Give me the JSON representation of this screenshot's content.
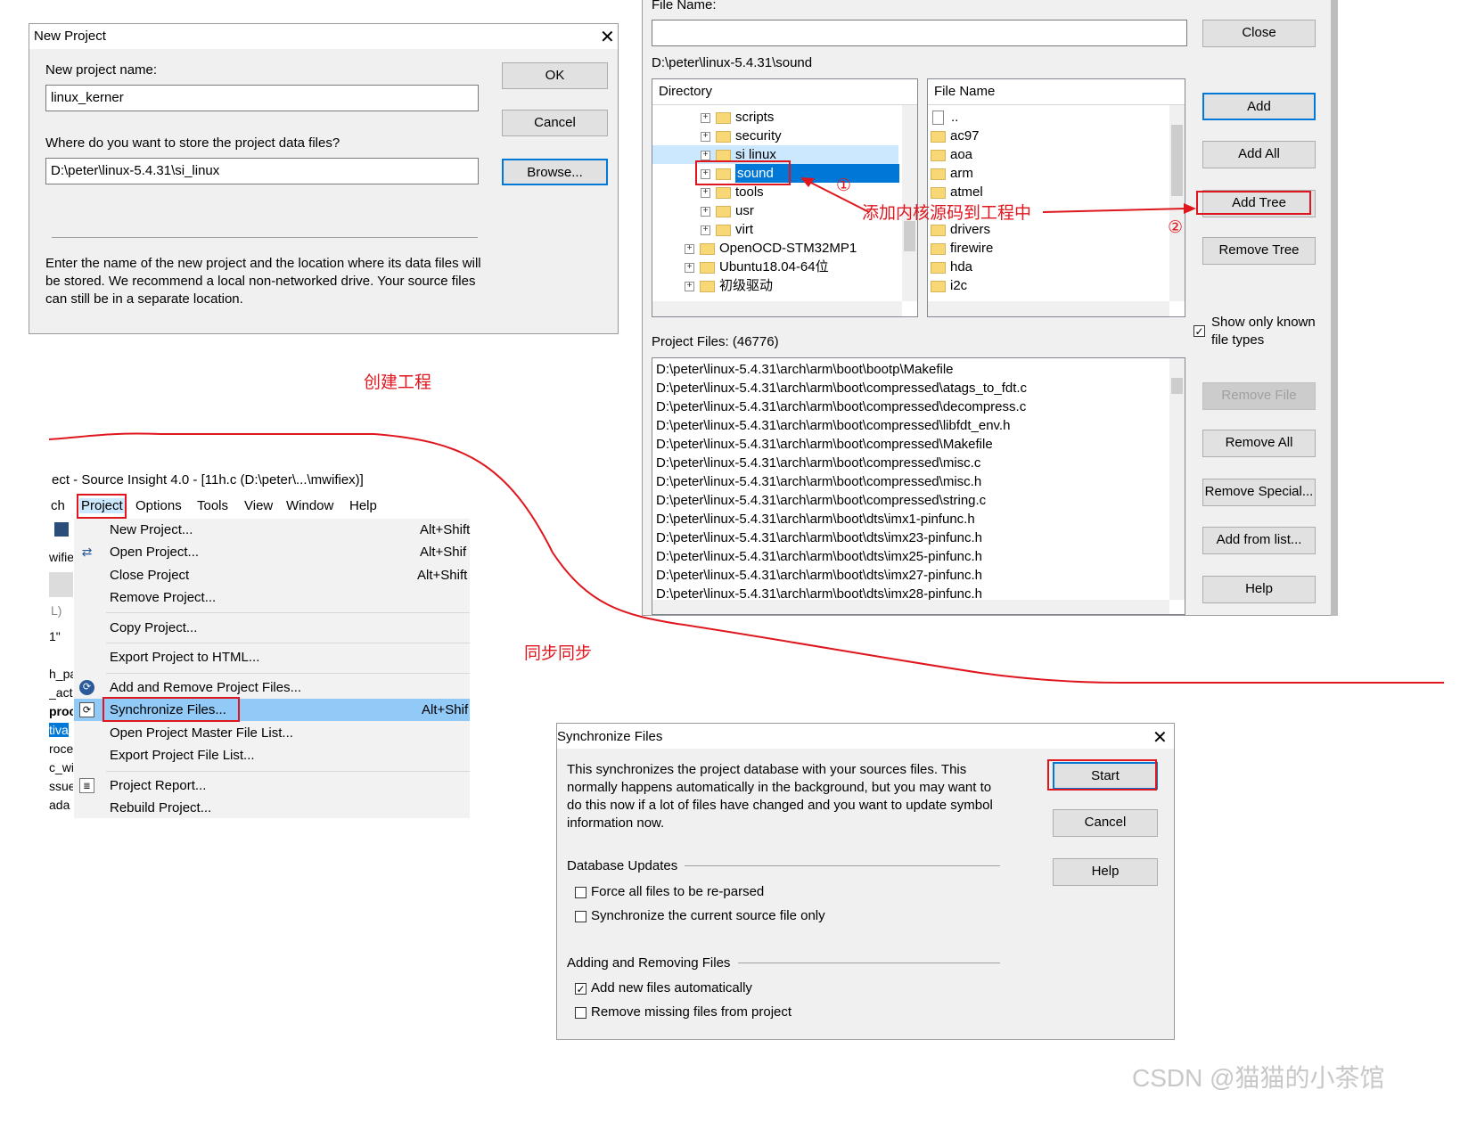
{
  "new_project": {
    "title": "New Project",
    "name_label": "New project name:",
    "name_value": "linux_kerner",
    "store_label": "Where do you want to store the project data files?",
    "store_value": "D:\\peter\\linux-5.4.31\\si_linux",
    "ok": "OK",
    "cancel": "Cancel",
    "browse": "Browse...",
    "description": "Enter the name of the new project and the location where its data files will be stored. We recommend a local non-networked drive. Your source files can still be in a separate location."
  },
  "add_files": {
    "file_name_label": "File Name:",
    "path": "D:\\peter\\linux-5.4.31\\sound",
    "directory_header": "Directory",
    "filename_header": "File Name",
    "directories": [
      {
        "label": "scripts"
      },
      {
        "label": "security"
      },
      {
        "label": "si linux"
      },
      {
        "label": "sound"
      },
      {
        "label": "tools"
      },
      {
        "label": "usr"
      },
      {
        "label": "virt"
      },
      {
        "label": "OpenOCD-STM32MP1"
      },
      {
        "label": "Ubuntu18.04-64位"
      },
      {
        "label": "初级驱动"
      }
    ],
    "files": [
      "..",
      "ac97",
      "aoa",
      "arm",
      "atmel",
      "drivers",
      "firewire",
      "hda",
      "i2c"
    ],
    "project_files_label": "Project Files: (46776)",
    "project_files": [
      "D:\\peter\\linux-5.4.31\\arch\\arm\\boot\\bootp\\Makefile",
      "D:\\peter\\linux-5.4.31\\arch\\arm\\boot\\compressed\\atags_to_fdt.c",
      "D:\\peter\\linux-5.4.31\\arch\\arm\\boot\\compressed\\decompress.c",
      "D:\\peter\\linux-5.4.31\\arch\\arm\\boot\\compressed\\libfdt_env.h",
      "D:\\peter\\linux-5.4.31\\arch\\arm\\boot\\compressed\\Makefile",
      "D:\\peter\\linux-5.4.31\\arch\\arm\\boot\\compressed\\misc.c",
      "D:\\peter\\linux-5.4.31\\arch\\arm\\boot\\compressed\\misc.h",
      "D:\\peter\\linux-5.4.31\\arch\\arm\\boot\\compressed\\string.c",
      "D:\\peter\\linux-5.4.31\\arch\\arm\\boot\\dts\\imx1-pinfunc.h",
      "D:\\peter\\linux-5.4.31\\arch\\arm\\boot\\dts\\imx23-pinfunc.h",
      "D:\\peter\\linux-5.4.31\\arch\\arm\\boot\\dts\\imx25-pinfunc.h",
      "D:\\peter\\linux-5.4.31\\arch\\arm\\boot\\dts\\imx27-pinfunc.h",
      "D:\\peter\\linux-5.4.31\\arch\\arm\\boot\\dts\\imx28-pinfunc.h"
    ],
    "buttons": {
      "close": "Close",
      "add": "Add",
      "add_all": "Add All",
      "add_tree": "Add Tree",
      "remove_tree": "Remove Tree",
      "remove_file": "Remove File",
      "remove_all": "Remove All",
      "remove_special": "Remove Special...",
      "add_from_list": "Add from list...",
      "help": "Help"
    },
    "show_known_label": "Show only known file types",
    "show_known_checked": true
  },
  "menu": {
    "window_title": "ect - Source Insight 4.0 - [11h.c (D:\\peter\\...\\mwifiex)]",
    "menubar": [
      "ch",
      "Project",
      "Options",
      "Tools",
      "View",
      "Window",
      "Help"
    ],
    "items": [
      {
        "label": "New Project...",
        "shortcut": "Alt+Shift"
      },
      {
        "label": "Open Project...",
        "shortcut": "Alt+Shif"
      },
      {
        "label": "Close Project",
        "shortcut": "Alt+Shift"
      },
      {
        "label": "Remove Project...",
        "shortcut": ""
      },
      {
        "label": "Copy Project...",
        "shortcut": ""
      },
      {
        "label": "Export Project to HTML...",
        "shortcut": ""
      },
      {
        "label": "Add and Remove Project Files...",
        "shortcut": ""
      },
      {
        "label": "Synchronize Files...",
        "shortcut": "Alt+Shif"
      },
      {
        "label": "Open Project Master File List...",
        "shortcut": ""
      },
      {
        "label": "Export Project File List...",
        "shortcut": ""
      },
      {
        "label": "Project Report...",
        "shortcut": ""
      },
      {
        "label": "Rebuild Project...",
        "shortcut": ""
      }
    ],
    "left_fragments": [
      "wifie",
      "L)",
      "1\"",
      "h_pa",
      "_acti",
      "proc",
      "tiva",
      "roce",
      "c_wi",
      "ssue",
      "ada"
    ]
  },
  "sync": {
    "title": "Synchronize Files",
    "description": "This synchronizes the project database with your sources files. This normally happens automatically in the background, but you may want to do this now if a lot of files have changed and you want to update symbol information now.",
    "start": "Start",
    "cancel": "Cancel",
    "help": "Help",
    "db_updates_label": "Database Updates",
    "force_reparse": "Force all files to be re-parsed",
    "force_reparse_checked": false,
    "sync_current": "Synchronize the current source file only",
    "sync_current_checked": false,
    "adding_removing_label": "Adding and Removing Files",
    "add_new": "Add new files automatically",
    "add_new_checked": true,
    "remove_missing": "Remove missing files from project",
    "remove_missing_checked": false
  },
  "annotations": {
    "create_project": "创建工程",
    "add_kernel_source": "添加内核源码到工程中",
    "sync_label": "同步同步",
    "step1": "①",
    "step2": "②",
    "watermark": "CSDN @猫猫的小茶馆"
  },
  "colors": {
    "accent": "#0078d7",
    "annotation": "#e0161e",
    "dialog_bg": "#f0f0f0"
  }
}
